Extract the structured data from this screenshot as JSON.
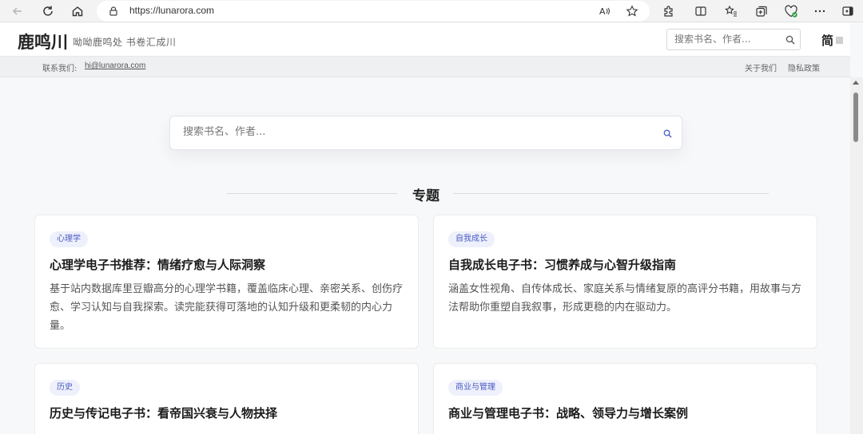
{
  "browser": {
    "url": "https://lunarora.com"
  },
  "header": {
    "logo": "鹿鸣川",
    "tagline": "呦呦鹿鸣处 书卷汇成川",
    "search_placeholder": "搜索书名、作者...",
    "lang_label": "简"
  },
  "infobar": {
    "contact_label": "联系我们:",
    "contact_email": "hi@lunarora.com",
    "about": "关于我们",
    "privacy": "隐私政策"
  },
  "main": {
    "search_placeholder": "搜索书名、作者...",
    "section_title": "专题"
  },
  "cards": [
    {
      "tag": "心理学",
      "title": "心理学电子书推荐：情绪疗愈与人际洞察",
      "desc": "基于站内数据库里豆瓣高分的心理学书籍，覆盖临床心理、亲密关系、创伤疗愈、学习认知与自我探索。读完能获得可落地的认知升级和更柔韧的内心力量。"
    },
    {
      "tag": "自我成长",
      "title": "自我成长电子书：习惯养成与心智升级指南",
      "desc": "涵盖女性视角、自传体成长、家庭关系与情绪复原的高评分书籍，用故事与方法帮助你重塑自我叙事，形成更稳的内在驱动力。"
    },
    {
      "tag": "历史",
      "title": "历史与传记电子书：看帝国兴衰与人物抉择",
      "desc": ""
    },
    {
      "tag": "商业与管理",
      "title": "商业与管理电子书：战略、领导力与增长案例",
      "desc": ""
    }
  ],
  "colors": {
    "accent": "#4a5bc4",
    "tag_bg": "#eef0fb"
  }
}
